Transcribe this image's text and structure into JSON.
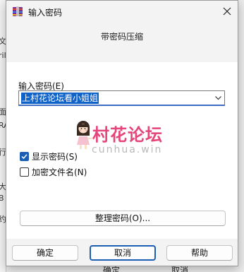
{
  "background": {
    "left_fragments": [
      "文",
      "ril",
      "面",
      "RA",
      "行",
      "大",
      "B",
      "约"
    ],
    "bottom_texts": [
      "确定",
      "取消"
    ]
  },
  "dialog": {
    "title": "输入密码",
    "heading": "带密码压缩",
    "password": {
      "label": "输入密码(E)",
      "value": "上村花论坛看小姐姐"
    },
    "watermark": {
      "title": "村花论坛",
      "url": "cunhua.win"
    },
    "show_password": {
      "label": "显示密码(S)",
      "checked": true
    },
    "encrypt_filenames": {
      "label": "加密文件名(N)",
      "checked": false
    },
    "organize_button": "整理密码(O)...",
    "buttons": {
      "ok": "确定",
      "cancel": "取消",
      "help": "帮助"
    }
  },
  "colors": {
    "accent": "#1a5fb4",
    "selection": "#0f62c8",
    "watermark": "#e6457a"
  }
}
